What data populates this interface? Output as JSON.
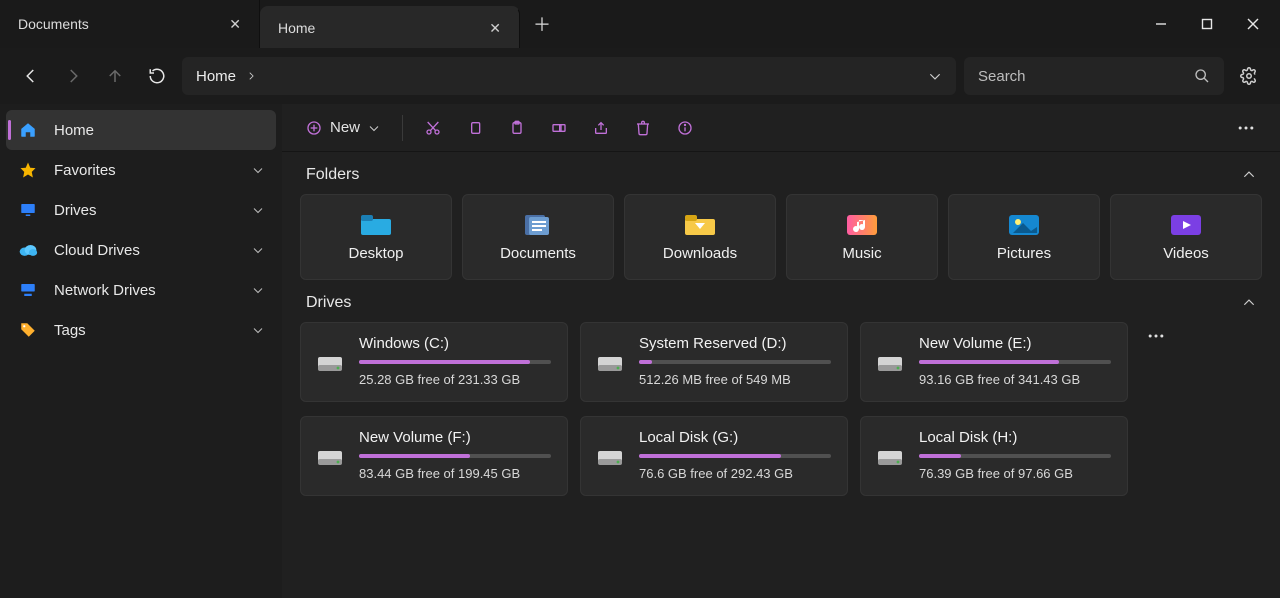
{
  "tabs": [
    {
      "label": "Documents",
      "active": false
    },
    {
      "label": "Home",
      "active": true
    }
  ],
  "nav": {
    "path": "Home"
  },
  "search": {
    "placeholder": "Search"
  },
  "sidebar": {
    "items": [
      {
        "label": "Home",
        "icon": "home",
        "active": true,
        "expandable": false
      },
      {
        "label": "Favorites",
        "icon": "star",
        "active": false,
        "expandable": true
      },
      {
        "label": "Drives",
        "icon": "monitor",
        "active": false,
        "expandable": true
      },
      {
        "label": "Cloud Drives",
        "icon": "cloud",
        "active": false,
        "expandable": true
      },
      {
        "label": "Network Drives",
        "icon": "network",
        "active": false,
        "expandable": true
      },
      {
        "label": "Tags",
        "icon": "tag",
        "active": false,
        "expandable": true
      }
    ]
  },
  "toolbar": {
    "new_label": "New"
  },
  "sections": {
    "folders_title": "Folders",
    "drives_title": "Drives"
  },
  "folders": [
    {
      "label": "Desktop",
      "icon": "desktop"
    },
    {
      "label": "Documents",
      "icon": "documents"
    },
    {
      "label": "Downloads",
      "icon": "downloads"
    },
    {
      "label": "Music",
      "icon": "music"
    },
    {
      "label": "Pictures",
      "icon": "pictures"
    },
    {
      "label": "Videos",
      "icon": "videos"
    }
  ],
  "drives": [
    {
      "name": "Windows (C:)",
      "free": "25.28 GB free of 231.33 GB",
      "used_pct": 89
    },
    {
      "name": "System Reserved (D:)",
      "free": "512.26 MB free of 549 MB",
      "used_pct": 7
    },
    {
      "name": "New Volume (E:)",
      "free": "93.16 GB free of 341.43 GB",
      "used_pct": 73
    },
    {
      "name": "New Volume (F:)",
      "free": "83.44 GB free of 199.45 GB",
      "used_pct": 58
    },
    {
      "name": "Local Disk (G:)",
      "free": "76.6 GB free of 292.43 GB",
      "used_pct": 74
    },
    {
      "name": "Local Disk (H:)",
      "free": "76.39 GB free of 97.66 GB",
      "used_pct": 22
    }
  ]
}
